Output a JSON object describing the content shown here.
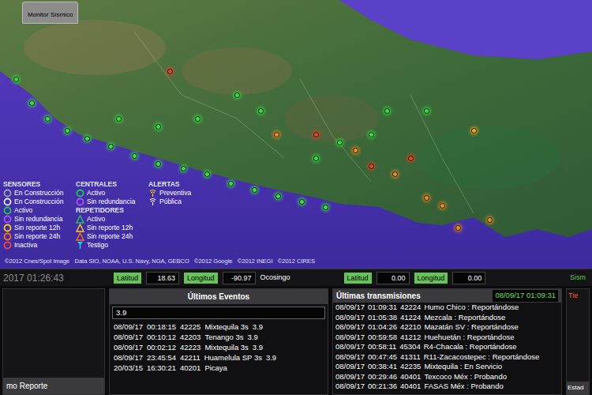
{
  "window": {
    "title": "Monitor Sísmico"
  },
  "map": {
    "attribution": "©2012 Cnes/Spot Image   Data SIO, NOAA, U.S. Navy, NGA, GEBCO   ©2012 Google   ©2012 INEGI   ©2012 CIRES",
    "markers": [
      {
        "color": "#3ddc4a"
      },
      {
        "color": "#3ddc4a"
      },
      {
        "color": "#3ddc4a"
      },
      {
        "color": "#3ddc4a"
      },
      {
        "color": "#3ddc4a"
      },
      {
        "color": "#3ddc4a"
      },
      {
        "color": "#3ddc4a"
      },
      {
        "color": "#3ddc4a"
      },
      {
        "color": "#3ddc4a"
      },
      {
        "color": "#3ddc4a"
      },
      {
        "color": "#3ddc4a"
      },
      {
        "color": "#3ddc4a"
      },
      {
        "color": "#3ddc4a"
      },
      {
        "color": "#3ddc4a"
      },
      {
        "color": "#3ddc4a"
      },
      {
        "color": "#3ddc4a"
      },
      {
        "color": "#3ddc4a"
      },
      {
        "color": "#3ddc4a"
      },
      {
        "color": "#3ddc4a"
      },
      {
        "color": "#3ddc4a"
      },
      {
        "color": "#3ddc4a"
      },
      {
        "color": "#3ddc4a"
      },
      {
        "color": "#3ddc4a"
      },
      {
        "color": "#3ddc4a"
      },
      {
        "color": "#3ddc4a"
      },
      {
        "color": "#f08a24"
      },
      {
        "color": "#e8432e"
      },
      {
        "color": "#f08a24"
      },
      {
        "color": "#e8432e"
      },
      {
        "color": "#f08a24"
      },
      {
        "color": "#e8432e"
      },
      {
        "color": "#f08a24"
      },
      {
        "color": "#f08a24"
      },
      {
        "color": "#f08a24"
      },
      {
        "color": "#f5a623"
      },
      {
        "color": "#f08a24"
      },
      {
        "color": "#e8432e"
      }
    ]
  },
  "legend": {
    "sensors": {
      "title": "SENSORES",
      "items": [
        {
          "label": "En Construcción",
          "kind": "ring",
          "color": "#9ca3af"
        },
        {
          "label": "En Construcción",
          "kind": "ring",
          "color": "#e5e7eb"
        },
        {
          "label": "Activo",
          "kind": "ring",
          "color": "#22c55e"
        },
        {
          "label": "Sin redundancia",
          "kind": "ring",
          "color": "#a855f7"
        },
        {
          "label": "Sin reporte 12h",
          "kind": "ring",
          "color": "#facc15"
        },
        {
          "label": "Sin reporte 24h",
          "kind": "ring",
          "color": "#f97316"
        },
        {
          "label": "Inactiva",
          "kind": "ring",
          "color": "#ef4444"
        }
      ]
    },
    "centrales": {
      "title": "CENTRALES",
      "items": [
        {
          "label": "Activo",
          "kind": "ring",
          "color": "#22c55e"
        },
        {
          "label": "Sin redundancia",
          "kind": "ring",
          "color": "#a855f7"
        }
      ]
    },
    "repeaters": {
      "title": "REPETIDORES",
      "items": [
        {
          "label": "Activo",
          "kind": "triangle",
          "color": "#22c55e"
        },
        {
          "label": "Sin reporte 12h",
          "kind": "triangle",
          "color": "#facc15"
        },
        {
          "label": "Sin reporte 24h",
          "kind": "triangle",
          "color": "#f97316"
        },
        {
          "label": "Testigo",
          "kind": "pin",
          "color": "#22d3ee"
        }
      ]
    },
    "alerts": {
      "title": "ALERTAS",
      "items": [
        {
          "label": "Preventiva",
          "kind": "wave",
          "color": "#facc15"
        },
        {
          "label": "Pública",
          "kind": "wave",
          "color": "#ffffff"
        }
      ]
    }
  },
  "status_bar": {
    "time": "2017 01:26:43",
    "coords": [
      {
        "label": "Latitud",
        "value": "18.63"
      },
      {
        "label": "Longitud",
        "value": "-90.97"
      }
    ],
    "place": "Ocosingo",
    "coords2": [
      {
        "label": "Latitud",
        "value": "0.00"
      },
      {
        "label": "Longitud",
        "value": "0.00"
      }
    ],
    "extra": "Sism"
  },
  "left_panel": {
    "title": "mo Reporte"
  },
  "events": {
    "title": "Últimos Eventos",
    "filter": "3.9",
    "rows": [
      [
        "08/09/17",
        "00:18:15",
        "42225",
        "Mixtequila 3s",
        "3.9"
      ],
      [
        "08/09/17",
        "00:10:12",
        "42203",
        "Tenango 3s",
        "3.9"
      ],
      [
        "08/09/17",
        "00:02:12",
        "42223",
        "Mixtequila 3s",
        "3.9"
      ],
      [
        "08/09/17",
        "23:45:54",
        "42211",
        "Huamelula SP 3s",
        "3.9"
      ],
      [
        "20/03/15",
        "16:30:21",
        "40201",
        "Picaya",
        ""
      ]
    ]
  },
  "transmissions": {
    "title": "Últimas transmisiones",
    "time": "08/09/17 01:09:31",
    "rows": [
      [
        "08/09/17",
        "01:09:31",
        "42224",
        "Humo Chico : Reportándose"
      ],
      [
        "08/09/17",
        "01:05:38",
        "41224",
        "Mezcala : Reportándose"
      ],
      [
        "08/09/17",
        "01:04:26",
        "42210",
        "Mazatán SV : Reportándose"
      ],
      [
        "08/09/17",
        "00:59:58",
        "41212",
        "Huehuetán : Reportándose"
      ],
      [
        "08/09/17",
        "00:58:11",
        "45304",
        "R4-Chacala : Reportándose"
      ],
      [
        "08/09/17",
        "00:47:45",
        "41311",
        "R11-Zacacostepec : Reportándose"
      ],
      [
        "08/09/17",
        "00:38:41",
        "42235",
        "Mixtequila : En Servicio"
      ],
      [
        "08/09/17",
        "00:29:46",
        "40401",
        "Texcoco Méx : Probando"
      ],
      [
        "08/09/17",
        "00:21:36",
        "40401",
        "FASAS Méx : Probando"
      ]
    ]
  },
  "side": {
    "top": "Tie",
    "bottom": "Estad"
  }
}
